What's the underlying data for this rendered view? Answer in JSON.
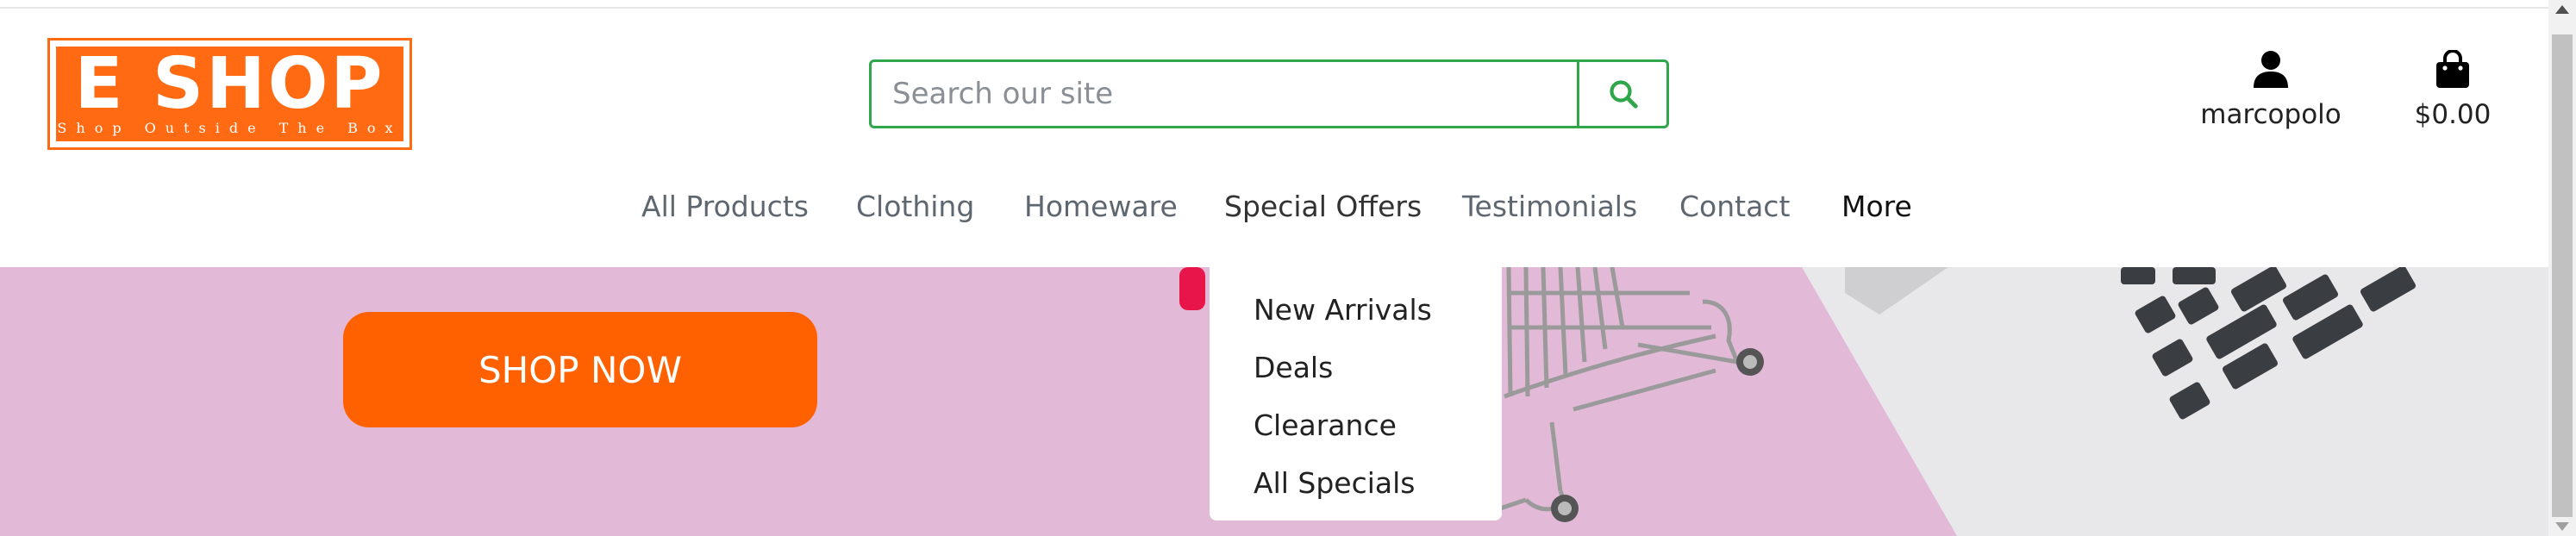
{
  "colors": {
    "brand_orange": "#ff6a13",
    "search_green": "#2fa64a",
    "hero_pink": "#e2b9d7",
    "button_orange": "#ff6000"
  },
  "logo": {
    "title": "E SHOP",
    "tagline": "Shop Outside The Box"
  },
  "search": {
    "placeholder": "Search our site",
    "value": "",
    "icon": "search-icon"
  },
  "account": {
    "label": "marcopolo",
    "icon": "user-icon"
  },
  "cart": {
    "label": "$0.00",
    "icon": "shopping-bag-icon"
  },
  "nav": {
    "items": [
      {
        "label": "All Products"
      },
      {
        "label": "Clothing"
      },
      {
        "label": "Homeware"
      },
      {
        "label": "Special Offers"
      },
      {
        "label": "Testimonials"
      },
      {
        "label": "Contact"
      },
      {
        "label": "More"
      }
    ]
  },
  "dropdown": {
    "items": [
      {
        "label": "New Arrivals"
      },
      {
        "label": "Deals"
      },
      {
        "label": "Clearance"
      },
      {
        "label": "All Specials"
      }
    ]
  },
  "hero": {
    "button_label": "SHOP NOW"
  }
}
